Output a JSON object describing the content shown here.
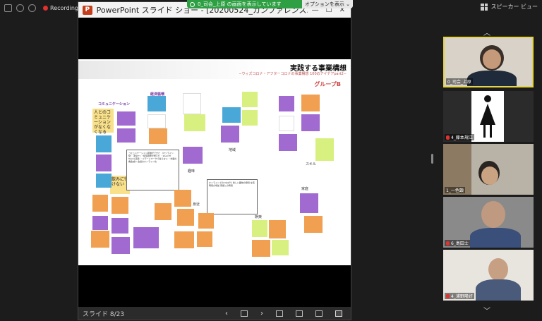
{
  "zoom": {
    "recording_label": "Recording",
    "speaker_view_label": "スピーカー ビュー",
    "share_banner": "0_司会_上原 の画面を表示しています",
    "share_options": "オプションを表示 ⌄"
  },
  "ppt": {
    "window_title": "PowerPoint スライド ショー - [20200524_カンファレンス...",
    "slide_counter": "スライド 8/23",
    "nav_prev": "‹",
    "nav_next": "›"
  },
  "slide": {
    "title": "実践する事業構想",
    "subtitle": "−ウィズコロナ・アフターコロナの事業構想 100のアイデアpart2−",
    "group": "グループB",
    "categories": {
      "communication": "コミュニケーション",
      "economy": "経済循環"
    },
    "labels": {
      "skill": "スキル",
      "hobby": "趣味",
      "home": "家庭",
      "neighbor": "身近",
      "local": "地域",
      "leisure": "娯楽"
    },
    "notes": {
      "pink_big": "人とのコミュニケーションがなくなくなる",
      "yellow_big": "飲みに行けない"
    },
    "memo1": "コミュニケーション距離ができた\n（オンライン化） 変化(*)\n・在宅勤務が増えた\n・ZoomやTeams活用\n・リモートワークで会えない\n・対面の機会減少\n会議のオンライン化",
    "memo2": "オンラインでのつながり\n新しい趣味の発見\n在宅時間の増加\n家族との時間"
  },
  "participants": [
    {
      "name": "0_司会_上原",
      "muted": false,
      "active": true
    },
    {
      "name": "4_藤本規江",
      "muted": true,
      "active": false
    },
    {
      "name": "1_一色顕",
      "muted": false,
      "active": false
    },
    {
      "name": "6_島田士",
      "muted": true,
      "active": false
    },
    {
      "name": "4_浦野隆好",
      "muted": true,
      "active": false
    }
  ],
  "colors": {
    "share_green": "#2ea043",
    "active_border": "#e5d44a",
    "ppt_red": "#c43e1c",
    "group_red": "#d04040",
    "category_purple": "#7030a0"
  }
}
